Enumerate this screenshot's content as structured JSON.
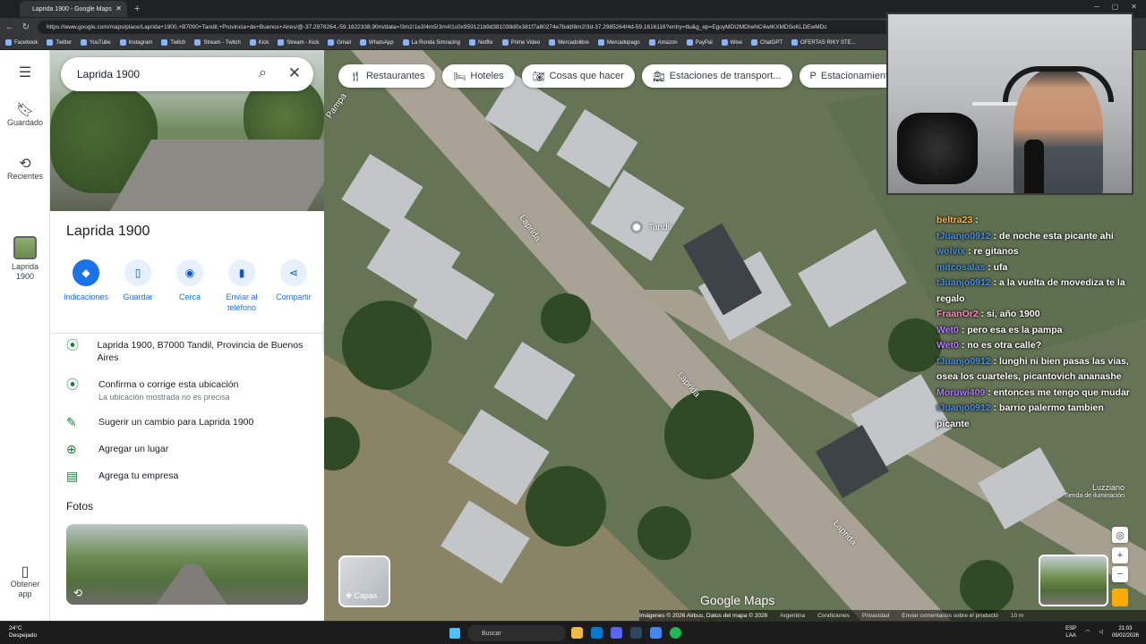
{
  "browser": {
    "tab_title": "Laprida 1900 - Google Maps",
    "url": "https://www.google.com/maps/place/Laprida+1900,+B7000+Tandil,+Provincia+de+Buenos+Aires/@-37.2978264,-59.1622338,90m/data=!3m1!1e3!4m5!3m4!1s0x959121b9d381038d0x381f7a80274e7bdd!8m2!3d-37.2985264!4d-59.1616116?entry=ttu&g_ep=EgoyMDI2MDIwNC4wIKXMDSoKLDEwMDc",
    "bookmarks": [
      "Facebook",
      "Twitter",
      "YouTube",
      "Instagram",
      "Twitch",
      "Stream - Twitch",
      "Kick",
      "Stream - Kick",
      "Gmail",
      "WhatsApp",
      "La Ronda Simracing",
      "Netflix",
      "Prime Video",
      "Mercadolibre",
      "Mercadopago",
      "Amazon",
      "PayPal",
      "Wise",
      "ChatGPT",
      "OFERTAS RIKY STE..."
    ]
  },
  "rail": {
    "saved": "Guardado",
    "recent": "Recientes",
    "place": "Laprida 1900",
    "get_app": "Obtener app"
  },
  "search": {
    "value": "Laprida 1900"
  },
  "panel": {
    "title": "Laprida 1900",
    "actions": [
      {
        "label": "Indicaciones",
        "icon": "directions-icon"
      },
      {
        "label": "Guardar",
        "icon": "bookmark-icon"
      },
      {
        "label": "Cerca",
        "icon": "nearby-icon"
      },
      {
        "label": "Enviar al teléfono",
        "icon": "phone-icon"
      },
      {
        "label": "Compartir",
        "icon": "share-icon"
      }
    ],
    "address": "Laprida 1900, B7000 Tandil, Provincia de Buenos Aires",
    "confirm": "Confirma o corrige esta ubicación",
    "confirm_sub": "La ubicación mostrada no es precisa",
    "suggest": "Sugerir un cambio para Laprida 1900",
    "add_place": "Agregar un lugar",
    "add_business": "Agrega tu empresa",
    "photos_heading": "Fotos"
  },
  "map": {
    "chips": [
      "Restaurantes",
      "Hoteles",
      "Cosas que hacer",
      "Estaciones de transport...",
      "Estacionamientos"
    ],
    "pin_label": "Tandil",
    "street_labels": [
      "Laprida",
      "Laprida",
      "Laprida",
      "Pampa"
    ],
    "layers_label": "Capas",
    "logo": "Google Maps",
    "attribution": "Imágenes © 2026 Airbus, Datos del mapa © 2026",
    "links": [
      "Argentina",
      "Condiciones",
      "Privacidad",
      "Enviar comentarios sobre el producto"
    ],
    "scale": "10 m",
    "business_name": "Luzziano",
    "business_type": "Tienda de iluminación"
  },
  "chat": [
    {
      "user": "beltra23",
      "text": ":",
      "color": "orange"
    },
    {
      "user": "tJuanjo0912",
      "text": ": de noche esta picante ahi",
      "color": "blue"
    },
    {
      "user": "wolvix",
      "text": ": re gitanos",
      "color": "blue"
    },
    {
      "user": "mitcosalas",
      "text": ": ufa",
      "color": "blue"
    },
    {
      "user": "tJuanjo0912",
      "text": ": a la vuelta de movediza te la regalo",
      "color": "blue"
    },
    {
      "user": "FraanOr2",
      "text": ": si, año 1900",
      "color": "pink"
    },
    {
      "user": "Wet0",
      "text": ": pero esa es la pampa",
      "color": "purple"
    },
    {
      "user": "Wet0",
      "text": ": no es otra calle?",
      "color": "purple"
    },
    {
      "user": "tJuanjo0912",
      "text": ": lunghi ni bien pasas las vias, osea los cuarteles, picantovich ananashe",
      "color": "blue"
    },
    {
      "user": "Moruwi409",
      "text": ": entonces me tengo que mudar",
      "color": "purple"
    },
    {
      "user": "tJuanjo0912",
      "text": ": barrio palermo tambien picante",
      "color": "blue"
    }
  ],
  "taskbar": {
    "temp": "24°C",
    "weather": "Despejado",
    "search": "Buscar",
    "lang1": "ESP",
    "lang2": "LAA",
    "time": "21:03",
    "date": "09/02/2026"
  }
}
